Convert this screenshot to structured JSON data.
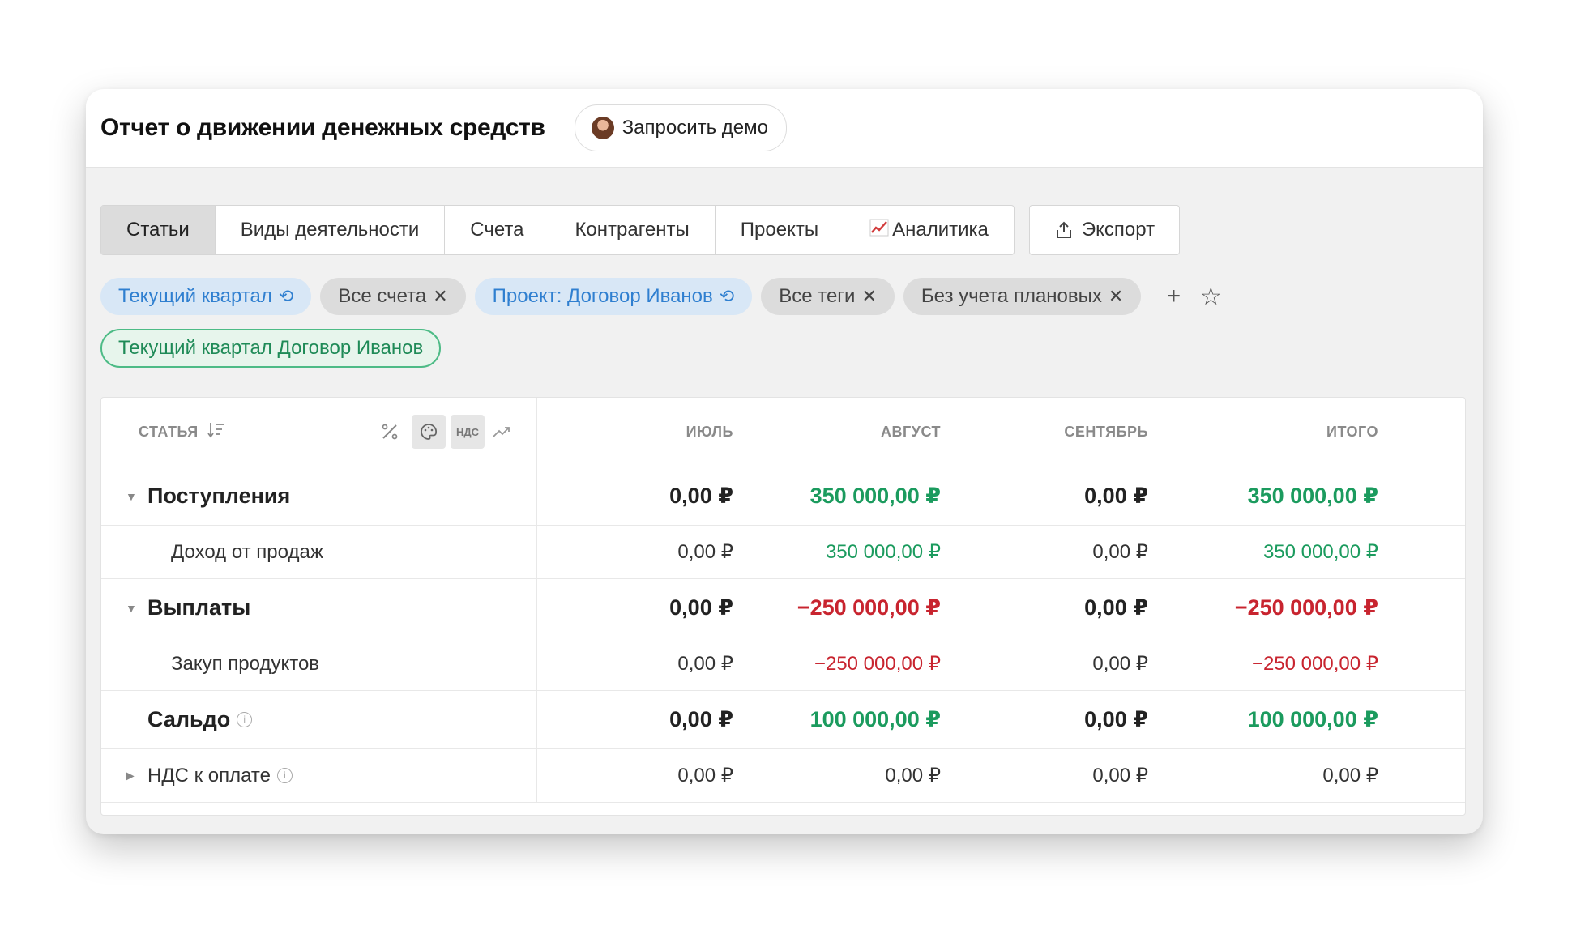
{
  "header": {
    "title": "Отчет о движении денежных средств",
    "demo_button": "Запросить демо"
  },
  "tabs": [
    {
      "label": "Статьи",
      "active": true
    },
    {
      "label": "Виды деятельности"
    },
    {
      "label": "Счета"
    },
    {
      "label": "Контрагенты"
    },
    {
      "label": "Проекты"
    },
    {
      "label": "Аналитика",
      "icon": "chart-icon"
    }
  ],
  "export_label": "Экспорт",
  "filters": [
    {
      "label": "Текущий квартал",
      "style": "blue",
      "icon": "reset-icon"
    },
    {
      "label": "Все счета",
      "style": "gray",
      "icon": "close-icon"
    },
    {
      "label": "Проект: Договор Иванов",
      "style": "blue",
      "icon": "reset-icon"
    },
    {
      "label": "Все теги",
      "style": "gray",
      "icon": "close-icon"
    },
    {
      "label": "Без учета плановых",
      "style": "gray",
      "icon": "close-icon"
    }
  ],
  "saved_filter": "Текущий квартал Договор Иванов",
  "table": {
    "columns": {
      "name": "СТАТЬЯ",
      "nds": "НДС",
      "m1": "ИЮЛЬ",
      "m2": "АВГУСТ",
      "m3": "СЕНТЯБРЬ",
      "total": "ИТОГО"
    },
    "rows": [
      {
        "name": "Поступления",
        "v": [
          "0,00 ₽",
          "350 000,00 ₽",
          "0,00 ₽",
          "350 000,00 ₽"
        ]
      },
      {
        "name": "Доход от продаж",
        "v": [
          "0,00 ₽",
          "350 000,00 ₽",
          "0,00 ₽",
          "350 000,00 ₽"
        ]
      },
      {
        "name": "Выплаты",
        "v": [
          "0,00 ₽",
          "−250 000,00 ₽",
          "0,00 ₽",
          "−250 000,00 ₽"
        ]
      },
      {
        "name": "Закуп продуктов",
        "v": [
          "0,00 ₽",
          "−250 000,00 ₽",
          "0,00 ₽",
          "−250 000,00 ₽"
        ]
      },
      {
        "name": "Сальдо",
        "v": [
          "0,00 ₽",
          "100 000,00 ₽",
          "0,00 ₽",
          "100 000,00 ₽"
        ]
      },
      {
        "name": "НДС к оплате",
        "v": [
          "0,00 ₽",
          "0,00 ₽",
          "0,00 ₽",
          "0,00 ₽"
        ]
      }
    ]
  },
  "colors": {
    "positive": "#1b9b5e",
    "negative": "#c8242f",
    "accent": "#2f7fd0"
  }
}
